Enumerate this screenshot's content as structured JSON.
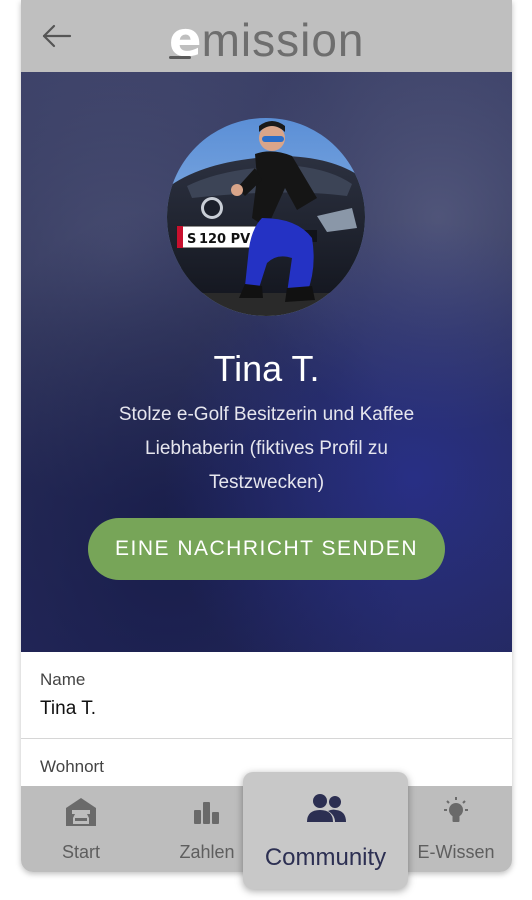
{
  "header": {
    "logo_e": "e",
    "logo_rest": "mission",
    "back_icon": "arrow-left-icon"
  },
  "profile": {
    "name": "Tina T.",
    "bio": "Stolze e-Golf Besitzerin und Kaffee Liebhaberin (fiktives Profil zu Testzwecken)",
    "message_button": "EINE NACHRICHT SENDEN",
    "plate": "S 120 PV"
  },
  "info": {
    "name_label": "Name",
    "name_value": "Tina T.",
    "residence_label": "Wohnort"
  },
  "nav": {
    "start": "Start",
    "zahlen": "Zahlen",
    "community": "Community",
    "ewissen": "E-Wissen"
  },
  "colors": {
    "header_bg": "#bfbfbf",
    "button_green": "#77a558",
    "nav_bg": "#bdbdbd",
    "active_text": "#2c2f52"
  }
}
